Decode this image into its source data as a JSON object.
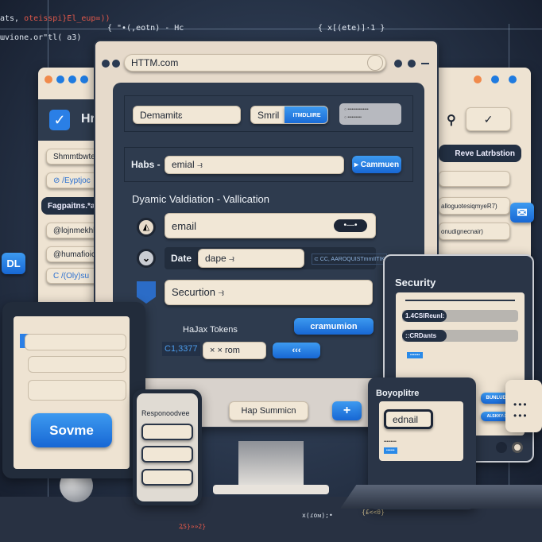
{
  "background_code": {
    "line1_plain": "ats, ",
    "line1_red": "oteisspi}El_eup=))",
    "line2": "ɯvione.or\"tl( a3)",
    "top_mid": "{ \"•(,eotn) - Hc",
    "top_right": "{ x[(ete)]·1 }",
    "bottom_a": "x(ɾoᴍ);•",
    "bottom_b": "{£<<θ}",
    "bottom_c": "ꝜS}»»2}"
  },
  "main_window": {
    "url": "HTTM.com",
    "row1": {
      "field": "Demamitɛ",
      "split_label": "Smril",
      "split_button": "ITMDLIIRE",
      "option_1": "•••••••••••••••",
      "option_2": "••••••••••"
    },
    "row2": {
      "label": "Habs -",
      "field": "emial ⥽",
      "button": "▸ Cammuen"
    },
    "section_title": "Dyamic Valdiation - Vallication",
    "email_field": "email",
    "date_label": "Date",
    "date_field": "dape ⥽",
    "date_extra": "⊂ CC, AAROQUISTmmIITIK",
    "security_field": "Securtion ⥽",
    "tokens_title": "HaJax Tokens",
    "tokens_button": "cramumion",
    "token_code": "C1,3377",
    "token_field": "×  ×   rom",
    "token_arrow_button": "‹‹‹",
    "bezel_button": "Hap Summicn",
    "plus_button": "+"
  },
  "left_window": {
    "header": "Hr",
    "items": [
      "Shmmtbwte",
      "/Eyptjoc",
      "Fagpaitns.*at",
      "@lojnmekhlut",
      "@humafioicok",
      "/(Oly)su"
    ]
  },
  "dl_badge": "DL",
  "right_window": {
    "button": "Reve Latrbstion",
    "items": [
      "alloguotesiqmyeR7)",
      "onudignecnair)"
    ]
  },
  "security_panel": {
    "title": "Security",
    "bar1_label": "1.4CSIReunl:",
    "bar2_label": "::CRDants",
    "badge": "•••••••",
    "button1": "BUNLUDI",
    "button2": "ALSKKY-1"
  },
  "small_tablet": {
    "title": "Boyoplitre",
    "field": "ednail",
    "caption": "•••••••••",
    "tag": "••••••"
  },
  "left_tablet": {
    "button": "Sovme"
  },
  "phone": {
    "title": "Responoodvee"
  },
  "colors": {
    "accent": "#1f7be0",
    "navy": "#2e3b4e",
    "beige": "#eee3d2",
    "orange_dot": "#f08a4b"
  }
}
